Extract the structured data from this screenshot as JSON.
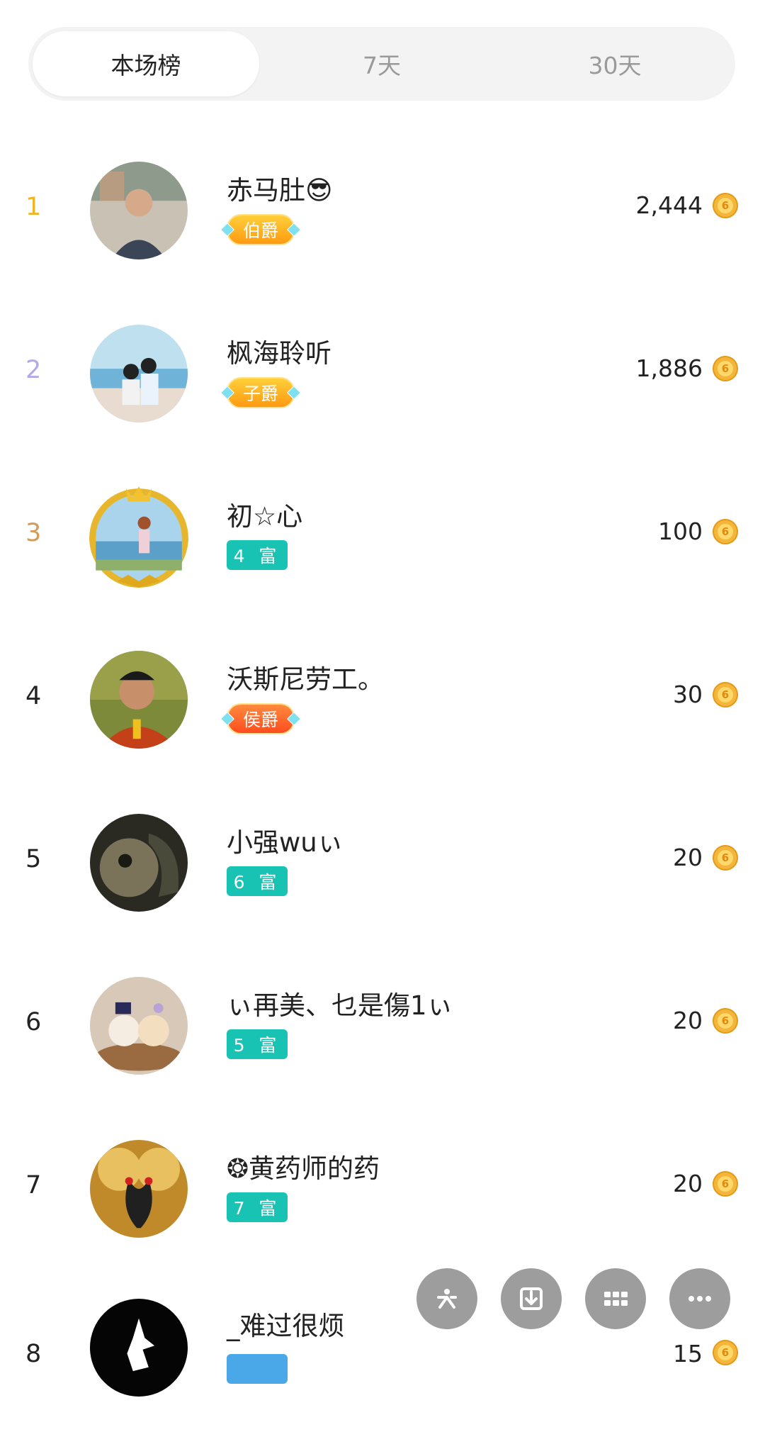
{
  "tabs": [
    {
      "label": "本场榜",
      "active": true
    },
    {
      "label": "7天",
      "active": false
    },
    {
      "label": "30天",
      "active": false
    }
  ],
  "rank_colors": {
    "1": "#f0b428",
    "2": "#b3a8ea",
    "3": "#d39a5a",
    "default": "#222222"
  },
  "coin_icon": "coin-icon",
  "entries": [
    {
      "rank": "1",
      "name": "赤马肚😎",
      "badge": "伯爵",
      "badge_type": "noble",
      "score": "2,444"
    },
    {
      "rank": "2",
      "name": "枫海聆听",
      "badge": "子爵",
      "badge_type": "noble",
      "score": "1,886"
    },
    {
      "rank": "3",
      "name": "初☆心",
      "badge": "4 富",
      "badge_type": "rich",
      "score": "100"
    },
    {
      "rank": "4",
      "name": "沃斯尼劳工。",
      "badge": "侯爵",
      "badge_type": "noble-red",
      "score": "30"
    },
    {
      "rank": "5",
      "name": "小强wuぃ",
      "badge": "6 富",
      "badge_type": "rich",
      "score": "20"
    },
    {
      "rank": "6",
      "name": "ぃ再美、乜是傷1ぃ",
      "badge": "5 富",
      "badge_type": "rich",
      "score": "20"
    },
    {
      "rank": "7",
      "name": "❂黄药师的药",
      "badge": "7 富",
      "badge_type": "rich",
      "score": "20"
    },
    {
      "rank": "8",
      "name": "_难过很烦",
      "badge": "",
      "badge_type": "rich",
      "score": "15"
    }
  ],
  "actions": [
    {
      "icon": "kuaishou-share-icon"
    },
    {
      "icon": "download-icon"
    },
    {
      "icon": "grid-icon"
    },
    {
      "icon": "more-icon"
    }
  ]
}
